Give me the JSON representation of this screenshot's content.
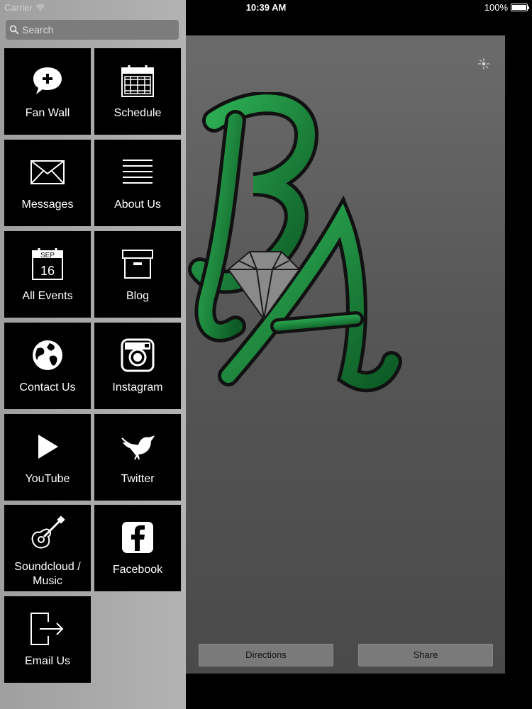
{
  "status_bar": {
    "carrier": "Carrier",
    "time": "10:39 AM",
    "battery": "100%"
  },
  "search": {
    "placeholder": "Search"
  },
  "menu": [
    {
      "label": "Fan Wall",
      "icon": "chat-plus-icon"
    },
    {
      "label": "Schedule",
      "icon": "calendar-icon"
    },
    {
      "label": "Messages",
      "icon": "envelope-icon"
    },
    {
      "label": "About Us",
      "icon": "lines-icon"
    },
    {
      "label": "All Events",
      "icon": "event-calendar-icon",
      "month": "SEP",
      "day": "16"
    },
    {
      "label": "Blog",
      "icon": "archive-box-icon"
    },
    {
      "label": "Contact Us",
      "icon": "globe-icon"
    },
    {
      "label": "Instagram",
      "icon": "camera-icon"
    },
    {
      "label": "YouTube",
      "icon": "play-icon"
    },
    {
      "label": "Twitter",
      "icon": "bird-icon"
    },
    {
      "label": "Soundcloud /\nMusic",
      "icon": "guitar-icon"
    },
    {
      "label": "Facebook",
      "icon": "facebook-icon"
    },
    {
      "label": "Email Us",
      "icon": "exit-arrow-icon"
    }
  ],
  "actions": {
    "directions": "Directions",
    "share": "Share"
  },
  "colors": {
    "logo_green": "#1f8a3c",
    "tile_bg": "#000000",
    "drawer_bg": "#acacac"
  }
}
